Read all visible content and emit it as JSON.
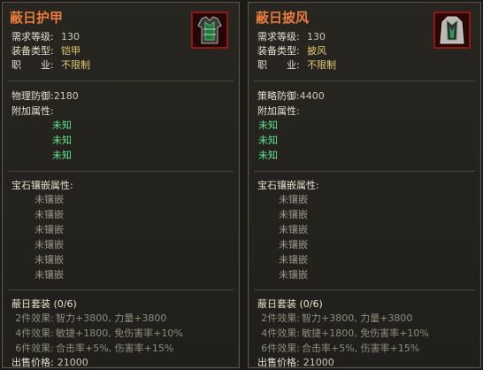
{
  "left": {
    "name": "蔽日护甲",
    "rows": [
      {
        "label": "需求等级:",
        "value": "130"
      },
      {
        "label": "装备类型:",
        "value": "铠甲"
      },
      {
        "label": "职　　业:",
        "value": "不限制"
      }
    ],
    "stat_label": "物理防御:",
    "stat_value": "2180",
    "extra_label": "附加属性:",
    "extra": [
      "未知",
      "未知",
      "未知"
    ],
    "gem_label": "宝石镶嵌属性:",
    "gems": [
      "未镶嵌",
      "未镶嵌",
      "未镶嵌",
      "未镶嵌",
      "未镶嵌",
      "未镶嵌"
    ],
    "set_label": "蔽日套装 (0/6)",
    "bonuses": [
      {
        "label": "2件效果:",
        "text": "智力+3800, 力量+3800"
      },
      {
        "label": "4件效果:",
        "text": "敏捷+1800, 免伤害率+10%"
      },
      {
        "label": "6件效果:",
        "text": "合击率+5%, 伤害率+15%"
      }
    ],
    "price_label": "出售价格:",
    "price": "21000"
  },
  "right": {
    "name": "蔽日披风",
    "rows": [
      {
        "label": "需求等级:",
        "value": "130"
      },
      {
        "label": "装备类型:",
        "value": "披风"
      },
      {
        "label": "职　　业:",
        "value": "不限制"
      }
    ],
    "stat_label": "策略防御:",
    "stat_value": "4400",
    "extra_label": "附加属性:",
    "extra": [
      "未知",
      "未知",
      "未知"
    ],
    "gem_label": "宝石镶嵌属性:",
    "gems": [
      "未镶嵌",
      "未镶嵌",
      "未镶嵌",
      "未镶嵌",
      "未镶嵌",
      "未镶嵌"
    ],
    "set_label": "蔽日套装 (0/6)",
    "bonuses": [
      {
        "label": "2件效果:",
        "text": "智力+3800, 力量+3800"
      },
      {
        "label": "4件效果:",
        "text": "敏捷+1800, 免伤害率+10%"
      },
      {
        "label": "6件效果:",
        "text": "合击率+5%, 伤害率+15%"
      }
    ],
    "price_label": "出售价格:",
    "price": "21000"
  },
  "colors": {
    "title": "#e87b3a",
    "value_yellow": "#e3c873",
    "unknown_green": "#5fe38b",
    "socket_gray": "#9a9588"
  },
  "icons": {
    "left": "armor-icon",
    "right": "cloak-icon"
  }
}
